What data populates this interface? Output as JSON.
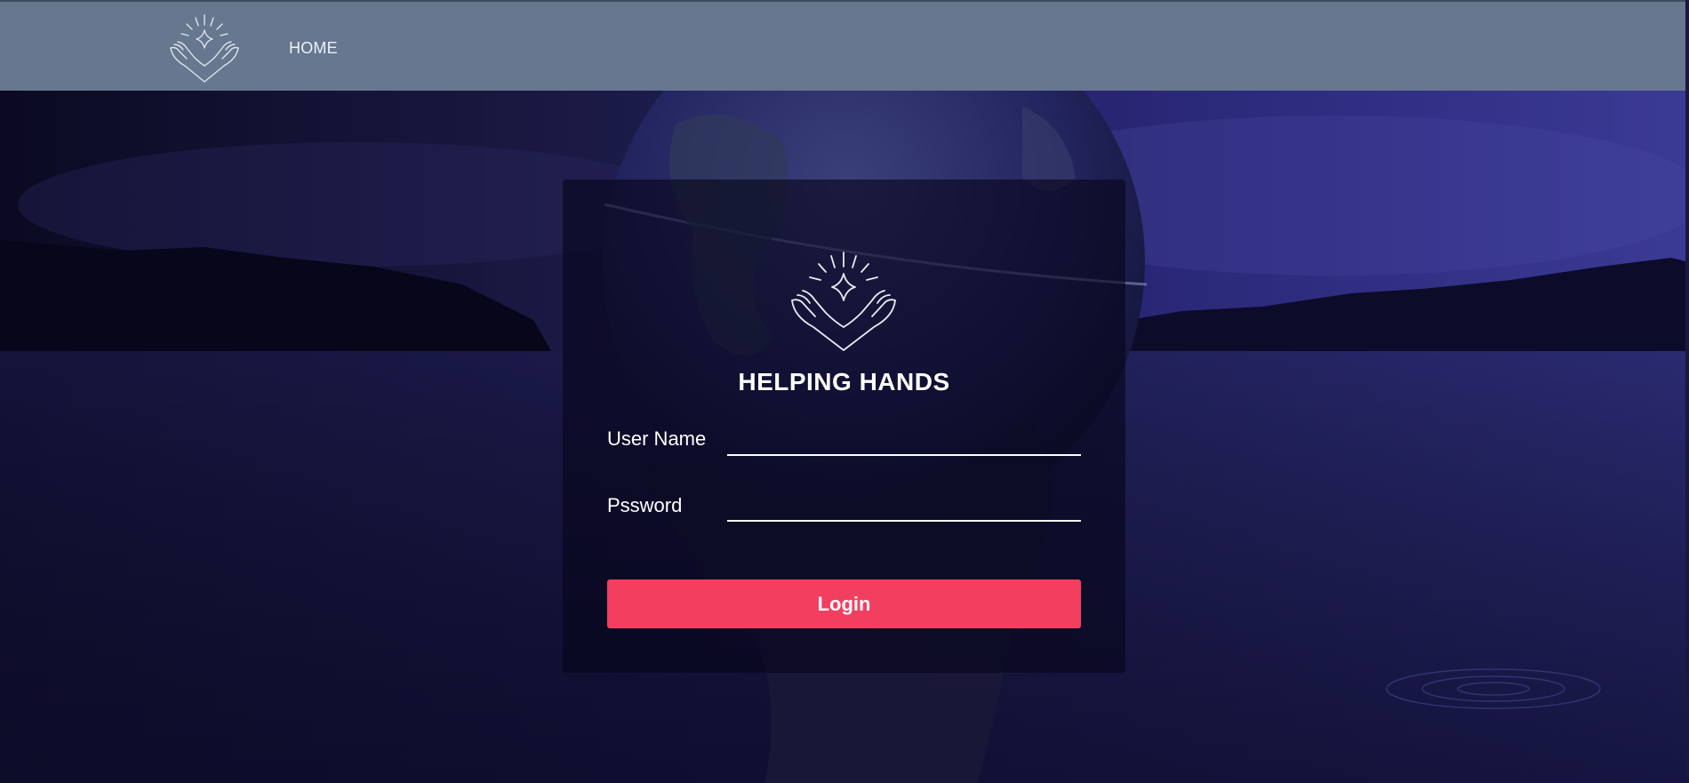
{
  "nav": {
    "logo_icon": "helping-hands-logo-icon",
    "home_label": "HOME"
  },
  "login": {
    "logo_icon": "helping-hands-logo-icon",
    "title": "HELPING HANDS",
    "username_label": "User Name",
    "username_value": "",
    "password_label": "Pssword",
    "password_value": "",
    "login_button_label": "Login"
  },
  "colors": {
    "navbar": "#66778f",
    "accent_button": "#f33f5f",
    "background_dark": "#0d0b2e",
    "background_purple": "#3a3590"
  }
}
